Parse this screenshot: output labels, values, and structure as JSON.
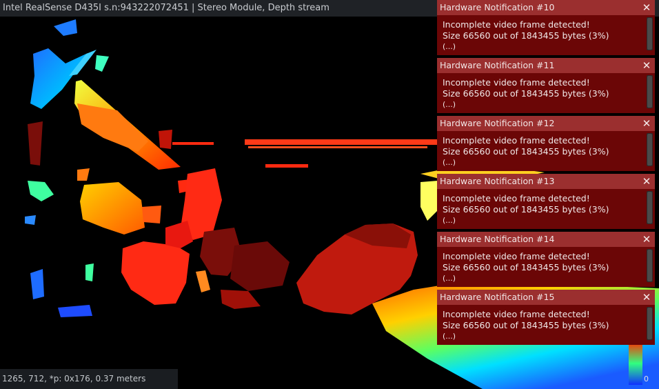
{
  "window": {
    "title": "Intel RealSense D435I s.n:943222072451 | Stereo Module, Depth stream"
  },
  "status": {
    "readout": "1265, 712, *p: 0x176, 0.37 meters"
  },
  "colorbar": {
    "min_label": "0"
  },
  "notifications": [
    {
      "title": "Hardware Notification #10",
      "line1": "Incomplete video frame detected!",
      "line2": "Size 66560 out of 1843455 bytes (3%)",
      "more": "(...)",
      "close": "✕"
    },
    {
      "title": "Hardware Notification #11",
      "line1": "Incomplete video frame detected!",
      "line2": "Size 66560 out of 1843455 bytes (3%)",
      "more": "(...)",
      "close": "✕"
    },
    {
      "title": "Hardware Notification #12",
      "line1": "Incomplete video frame detected!",
      "line2": "Size 66560 out of 1843455 bytes (3%)",
      "more": "(...)",
      "close": "✕"
    },
    {
      "title": "Hardware Notification #13",
      "line1": "Incomplete video frame detected!",
      "line2": "Size 66560 out of 1843455 bytes (3%)",
      "more": "(...)",
      "close": "✕"
    },
    {
      "title": "Hardware Notification #14",
      "line1": "Incomplete video frame detected!",
      "line2": "Size 66560 out of 1843455 bytes (3%)",
      "more": "(...)",
      "close": "✕"
    },
    {
      "title": "Hardware Notification #15",
      "line1": "Incomplete video frame detected!",
      "line2": "Size 66560 out of 1843455 bytes (3%)",
      "more": "(...)",
      "close": "✕"
    }
  ],
  "colors": {
    "notification_bg": "#6b0606",
    "notification_header": "#9b2f2f",
    "titlebar_bg": "#1f2226"
  },
  "icons": {
    "close": "close-icon"
  }
}
